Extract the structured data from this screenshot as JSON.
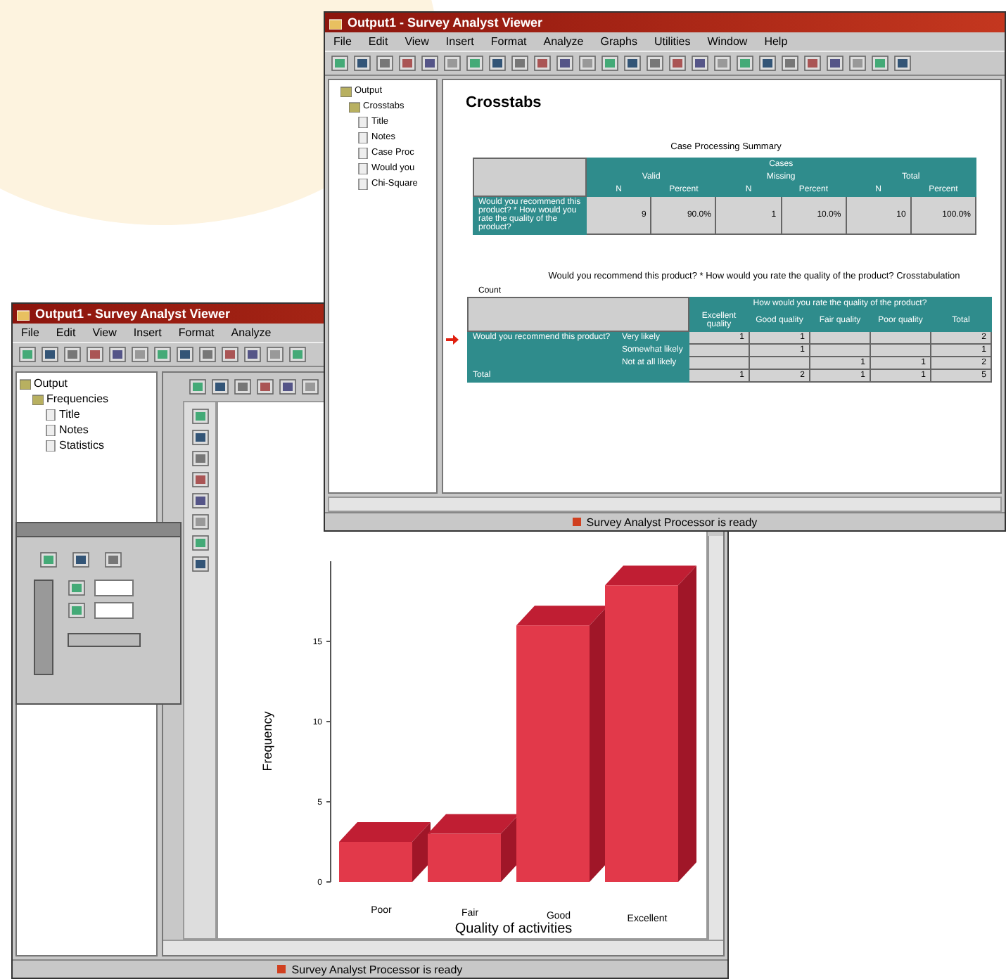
{
  "front_window": {
    "title": "Output1 - Survey Analyst Viewer",
    "menu": [
      "File",
      "Edit",
      "View",
      "Insert",
      "Format",
      "Analyze"
    ],
    "outline": [
      {
        "label": "Output",
        "children": [
          {
            "label": "Frequencies",
            "children": [
              {
                "label": "Title"
              },
              {
                "label": "Notes"
              },
              {
                "label": "Statistics"
              }
            ]
          }
        ]
      }
    ],
    "chart_data": {
      "type": "bar",
      "xlabel": "Quality of activities",
      "ylabel": "Frequency",
      "categories": [
        "Poor",
        "Fair",
        "Good",
        "Excellent"
      ],
      "values": [
        2.5,
        3,
        16,
        18.5
      ],
      "ylim": [
        0,
        20
      ],
      "yticks": [
        0,
        5,
        10,
        15
      ]
    },
    "status_bar": "Survey Analyst Processor is ready"
  },
  "back_window": {
    "title": "Output1 - Survey Analyst Viewer",
    "menu": [
      "File",
      "Edit",
      "View",
      "Insert",
      "Format",
      "Analyze",
      "Graphs",
      "Utilities",
      "Window",
      "Help"
    ],
    "outline": [
      {
        "label": "Output",
        "children": [
          {
            "label": "Crosstabs",
            "children": [
              {
                "label": "Title"
              },
              {
                "label": "Notes"
              },
              {
                "label": "Case Proc"
              },
              {
                "label": "Would you"
              },
              {
                "label": "Chi-Square"
              }
            ]
          }
        ]
      }
    ],
    "heading": "Crosstabs",
    "summary": {
      "title": "Case Processing Summary",
      "group": "Cases",
      "columns": [
        {
          "label": "Valid",
          "colspan": 2
        },
        {
          "label": "Missing",
          "colspan": 2
        },
        {
          "label": "Total",
          "colspan": 2
        }
      ],
      "subcolumns": [
        "N",
        "Percent",
        "N",
        "Percent",
        "N",
        "Percent"
      ],
      "rows": [
        {
          "label": "Would you recommend this product? * How would you rate the quality of the product?",
          "cells": [
            "9",
            "90.0%",
            "1",
            "10.0%",
            "10",
            "100.0%"
          ]
        }
      ]
    },
    "crosstab": {
      "title": "Would you recommend this product? * How would you rate the quality of the product? Crosstabulation",
      "caption": "Count",
      "group": "How would you rate the quality of the product?",
      "columns": [
        "Excellent quality",
        "Good quality",
        "Fair quality",
        "Poor quality",
        "Total"
      ],
      "row_variable": "Would you recommend this product?",
      "rows": [
        {
          "label": "Very likely",
          "cells": [
            "1",
            "1",
            "",
            "",
            "2"
          ]
        },
        {
          "label": "Somewhat likely",
          "cells": [
            "",
            "1",
            "",
            "",
            "1"
          ]
        },
        {
          "label": "Not at all likely",
          "cells": [
            "",
            "",
            "1",
            "1",
            "2"
          ]
        }
      ],
      "total": {
        "label": "Total",
        "cells": [
          "1",
          "2",
          "1",
          "1",
          "5"
        ]
      }
    },
    "status_bar": "Survey Analyst Processor is ready"
  }
}
